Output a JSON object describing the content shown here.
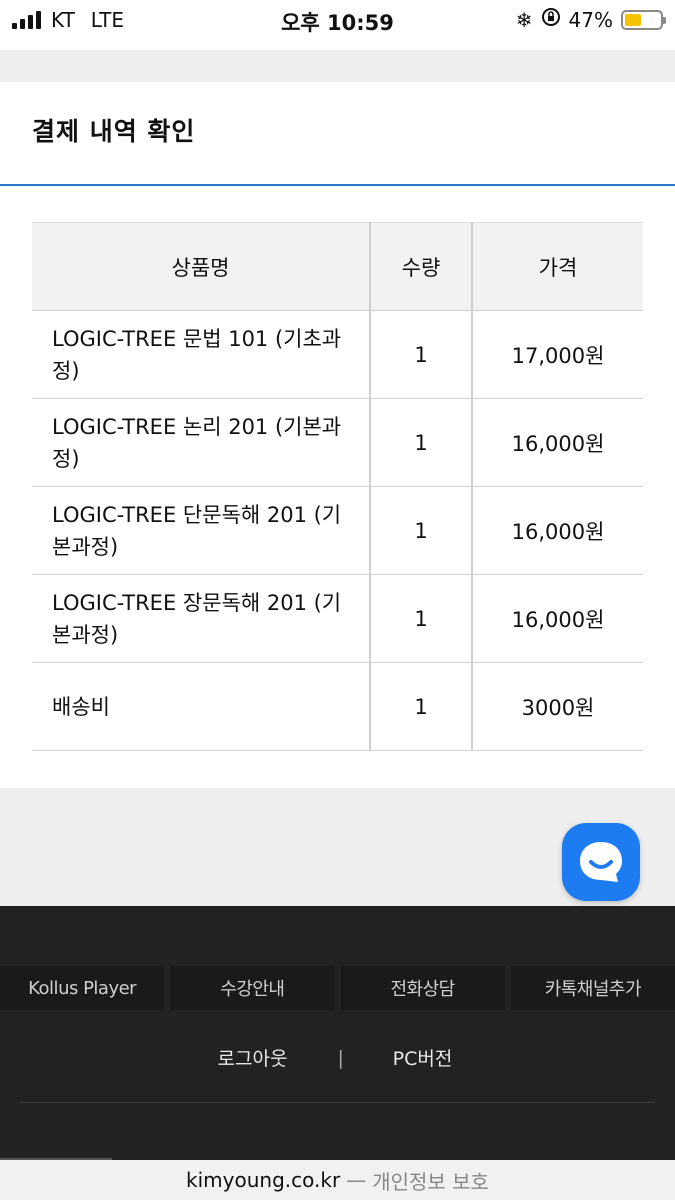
{
  "status_bar": {
    "carrier": "KT",
    "network": "LTE",
    "time": "오후 10:59",
    "battery": "47%",
    "battery_level": 0.47
  },
  "panel": {
    "title": "결제 내역 확인"
  },
  "table": {
    "headers": [
      "상품명",
      "수량",
      "가격"
    ],
    "rows": [
      {
        "name": "LOGIC-TREE 문법 101 (기초과정)",
        "qty": "1",
        "price": "17,000원"
      },
      {
        "name": "LOGIC-TREE 논리 201 (기본과정)",
        "qty": "1",
        "price": "16,000원"
      },
      {
        "name": "LOGIC-TREE 단문독해 201 (기본과정)",
        "qty": "1",
        "price": "16,000원"
      },
      {
        "name": "LOGIC-TREE 장문독해 201 (기본과정)",
        "qty": "1",
        "price": "16,000원"
      },
      {
        "name": "배송비",
        "qty": "1",
        "price": "3000원"
      }
    ]
  },
  "footer": {
    "tabs": [
      "Kollus Player",
      "수강안내",
      "전화상담",
      "카톡채널추가"
    ],
    "links": {
      "logout": "로그아웃",
      "divider": "|",
      "pc_version": "PC버전"
    }
  },
  "url_bar": {
    "domain": "kimyoung.co.kr",
    "separator": "—",
    "privacy": "개인정보 보호"
  },
  "colors": {
    "accent_rule": "#2d77c7",
    "chat_button": "#1e7cf2",
    "footer_bg": "#222222",
    "battery_fill": "#f5c400"
  }
}
